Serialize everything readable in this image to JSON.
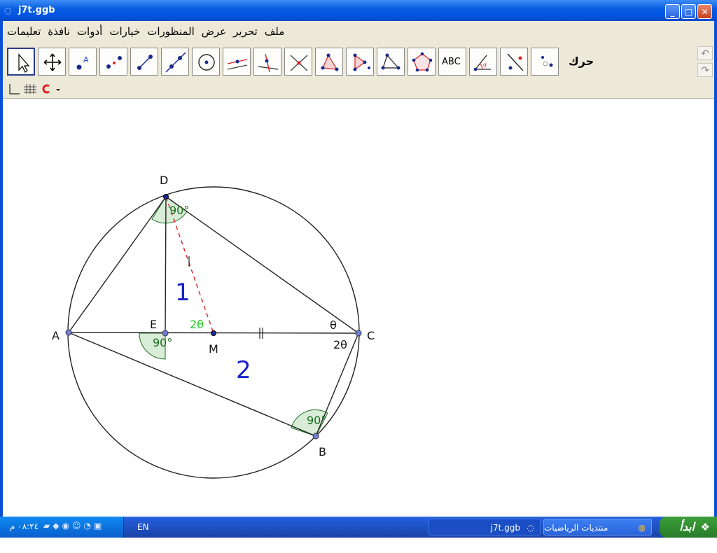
{
  "window": {
    "title": "j7t.ggb"
  },
  "menu": [
    "ملف",
    "تحرير",
    "عرض",
    "المنظورات",
    "خيارات",
    "أدوات",
    "نافذة",
    "تعليمات"
  ],
  "toolbar": {
    "current_tool_label": "حرك",
    "text_tool_label": "ABC"
  },
  "figure": {
    "point_labels": {
      "D": "D",
      "A": "A",
      "E": "E",
      "M": "M",
      "C": "C",
      "B": "B"
    },
    "angle_D": "90°",
    "angle_E": "90°",
    "angle_B": "90°",
    "angle_C_top": "θ",
    "angle_C_bottom": "2θ",
    "angle_M": "2θ",
    "region_1": "1",
    "region_2": "2"
  },
  "taskbar": {
    "start_label": "ابدأ",
    "task1": "منتديات الرياضيات المعا...",
    "task2": "j7t.ggb",
    "language": "EN",
    "clock": "٠٨:٢٤ م"
  },
  "colors": {
    "accent": "#0a5fe0",
    "angle_fill": "#d8ecd8",
    "angle_stroke": "#1a6b1a",
    "dashed_line": "#e02020",
    "region_label": "#1a22c8",
    "green_label": "#22cc22",
    "point_fill": "#6f80d8"
  }
}
